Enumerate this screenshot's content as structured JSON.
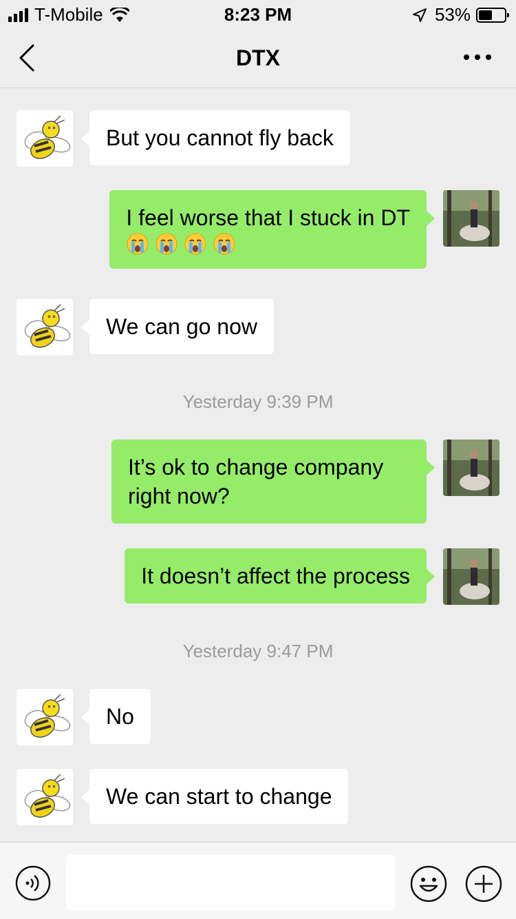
{
  "status_bar": {
    "carrier": "T-Mobile",
    "time": "8:23 PM",
    "battery_percent": "53%",
    "battery_level": 0.53,
    "signal_bars": 4
  },
  "nav": {
    "title": "DTX",
    "back_icon": "chevron-left-icon",
    "more_icon": "more-dots-icon"
  },
  "messages": [
    {
      "side": "in",
      "text": "But you cannot fly back"
    },
    {
      "side": "out",
      "text": "I feel worse that I stuck in DT",
      "emoji": [
        "crying-face-icon",
        "crying-face-icon",
        "crying-face-icon",
        "crying-face-icon"
      ]
    },
    {
      "side": "in",
      "text": "We can go now"
    },
    {
      "timestamp": "Yesterday 9:39 PM"
    },
    {
      "side": "out",
      "text": "It’s ok to change company right now?"
    },
    {
      "side": "out",
      "text": "It doesn’t affect the process"
    },
    {
      "timestamp": "Yesterday 9:47 PM"
    },
    {
      "side": "in",
      "text": "No"
    },
    {
      "side": "in",
      "text": "We can start to change"
    }
  ],
  "input_bar": {
    "voice_icon": "voice-icon",
    "emoji_icon": "emoji-icon",
    "plus_icon": "plus-icon",
    "input_value": ""
  },
  "colors": {
    "background": "#ededed",
    "bubble_out": "#95ec69",
    "bubble_in": "#ffffff",
    "timestamp": "#9a9a9a"
  }
}
